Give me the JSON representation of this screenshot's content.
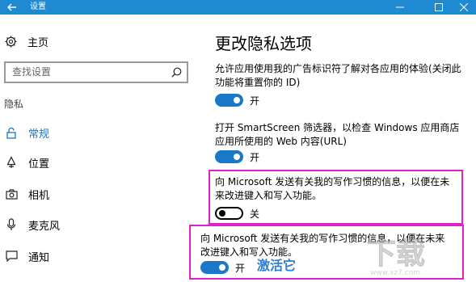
{
  "window": {
    "title": "设置",
    "controls": {
      "minimize": "—",
      "maximize": "☐",
      "close": "✕"
    }
  },
  "sidebar": {
    "home_label": "主页",
    "search_placeholder": "查找设置",
    "section_label": "隐私",
    "items": [
      {
        "label": "常规",
        "icon": "lock-icon",
        "active": true
      },
      {
        "label": "位置",
        "icon": "location-icon",
        "active": false
      },
      {
        "label": "相机",
        "icon": "camera-icon",
        "active": false
      },
      {
        "label": "麦克风",
        "icon": "microphone-icon",
        "active": false
      },
      {
        "label": "通知",
        "icon": "notification-icon",
        "active": false
      }
    ]
  },
  "content": {
    "heading": "更改隐私选项",
    "settings": [
      {
        "text": "允许应用使用我的广告标识符了解对各应用的体验(关闭此功能将重置你的 ID)",
        "state": "开",
        "on": true
      },
      {
        "text": "打开 SmartScreen 筛选器，以检查 Windows 应用商店应用所使用的 Web 内容(URL)",
        "state": "开",
        "on": true
      },
      {
        "text": "向 Microsoft 发送有关我的写作习惯的信息，以便在未来改进键入和写入功能。",
        "state": "关",
        "on": false
      },
      {
        "text": "向 Microsoft 发送有关我的写作习惯的信息，以便在未来改进键入和写入功能。",
        "state": "开",
        "on": true
      }
    ],
    "annotation": "激活它"
  },
  "colors": {
    "titlebar": "#1f8ad2",
    "accent": "#1a78c8",
    "highlight_box": "#e022c8",
    "annotation": "#2e7ed6"
  }
}
